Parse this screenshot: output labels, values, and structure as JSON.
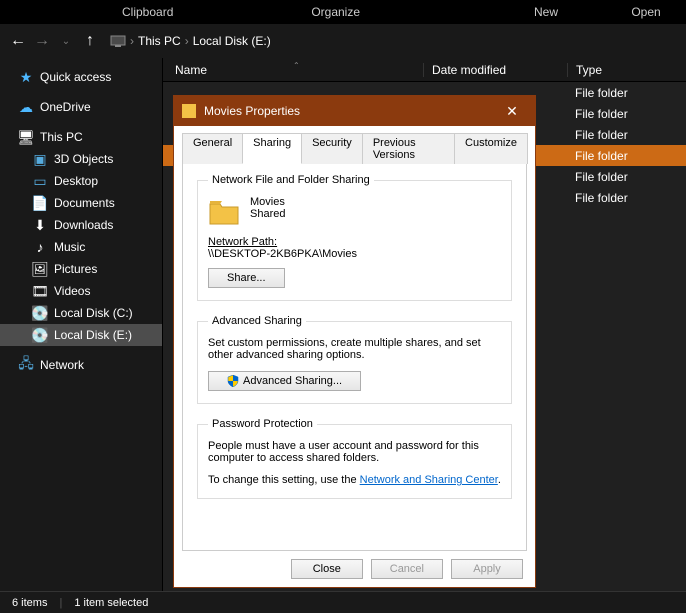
{
  "ribbon": {
    "clipboard": "Clipboard",
    "organize": "Organize",
    "new": "New",
    "open": "Open"
  },
  "breadcrumb": {
    "root": "This PC",
    "drive": "Local Disk (E:)"
  },
  "columns": {
    "name": "Name",
    "date": "Date modified",
    "type": "Type"
  },
  "sidebar": {
    "quick": "Quick access",
    "onedrive": "OneDrive",
    "thispc": "This PC",
    "objects3d": "3D Objects",
    "desktop": "Desktop",
    "documents": "Documents",
    "downloads": "Downloads",
    "music": "Music",
    "pictures": "Pictures",
    "videos": "Videos",
    "diskc": "Local Disk (C:)",
    "diske": "Local Disk (E:)",
    "network": "Network"
  },
  "filetype": "File folder",
  "status": {
    "items": "6 items",
    "selected": "1 item selected"
  },
  "dialog": {
    "title": "Movies Properties",
    "tabs": {
      "general": "General",
      "sharing": "Sharing",
      "security": "Security",
      "previous": "Previous Versions",
      "customize": "Customize"
    },
    "group_net": "Network File and Folder Sharing",
    "folder_name": "Movies",
    "folder_state": "Shared",
    "netpath_label": "Network Path:",
    "netpath_value": "\\\\DESKTOP-2KB6PKA\\Movies",
    "share_btn": "Share...",
    "group_adv": "Advanced Sharing",
    "adv_text": "Set custom permissions, create multiple shares, and set other advanced sharing options.",
    "adv_btn": "Advanced Sharing...",
    "group_pwd": "Password Protection",
    "pwd_text": "People must have a user account and password for this computer to access shared folders.",
    "pwd_change_prefix": "To change this setting, use the ",
    "pwd_link": "Network and Sharing Center",
    "close": "Close",
    "cancel": "Cancel",
    "apply": "Apply"
  }
}
